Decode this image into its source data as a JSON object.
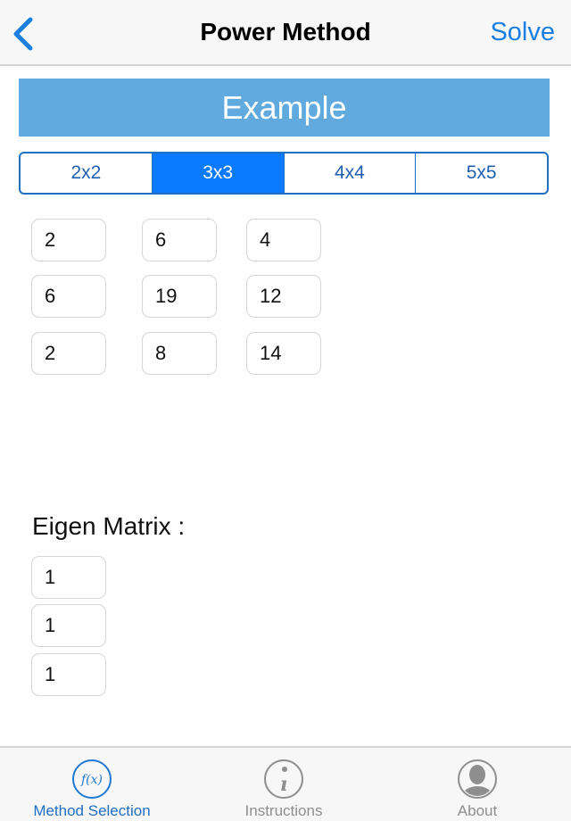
{
  "navbar": {
    "back_icon": "chevron-left-icon",
    "title": "Power Method",
    "action_label": "Solve"
  },
  "banner": {
    "title": "Example"
  },
  "size_selector": {
    "options": [
      "2x2",
      "3x3",
      "4x4",
      "5x5"
    ],
    "selected": "3x3"
  },
  "matrix": {
    "rows": [
      [
        "2",
        "6",
        "4"
      ],
      [
        "6",
        "19",
        "12"
      ],
      [
        "2",
        "8",
        "14"
      ]
    ]
  },
  "eigen": {
    "label": "Eigen Matrix :",
    "values": [
      "1",
      "1",
      "1"
    ]
  },
  "tabbar": {
    "items": [
      {
        "label": "Method Selection",
        "icon": "function-icon",
        "active": true
      },
      {
        "label": "Instructions",
        "icon": "info-icon",
        "active": false
      },
      {
        "label": "About",
        "icon": "person-icon",
        "active": false
      }
    ]
  },
  "colors": {
    "accent": "#0a7aff",
    "link": "#1a7fe0",
    "banner": "#60aae0",
    "tab_inactive": "#8e8e8e"
  }
}
